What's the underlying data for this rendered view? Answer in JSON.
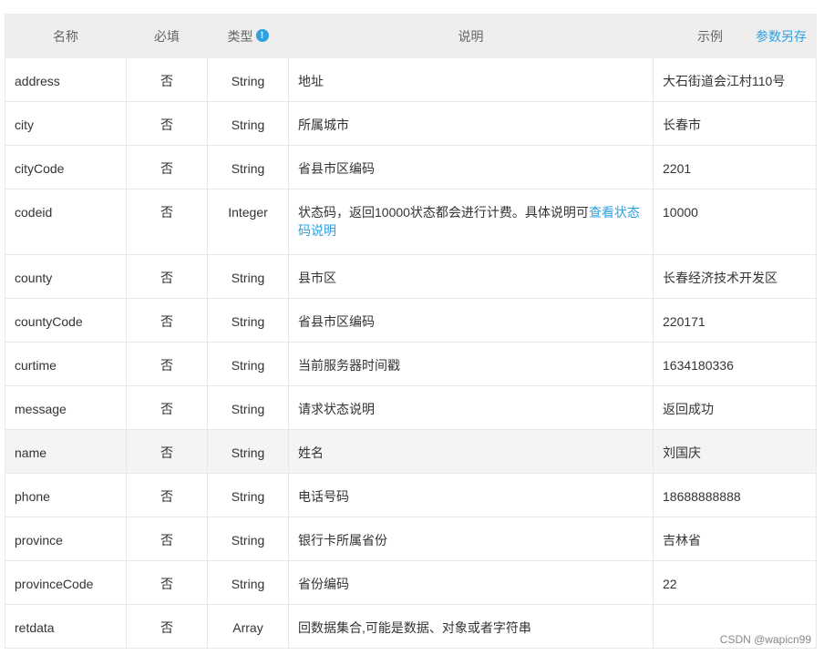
{
  "header": {
    "name": "名称",
    "required": "必填",
    "type": "类型",
    "type_info_icon": "!",
    "description": "说明",
    "example": "示例",
    "save_as": "参数另存"
  },
  "rows": [
    {
      "name": "address",
      "required": "否",
      "type": "String",
      "desc": "地址",
      "example": "大石街道会江村110号"
    },
    {
      "name": "city",
      "required": "否",
      "type": "String",
      "desc": "所属城市",
      "example": "长春市"
    },
    {
      "name": "cityCode",
      "required": "否",
      "type": "String",
      "desc": "省县市区编码",
      "example": "2201"
    },
    {
      "name": "codeid",
      "required": "否",
      "type": "Integer",
      "desc": "状态码，返回10000状态都会进行计费。具体说明可",
      "desc_link": "查看状态码说明",
      "example": "10000"
    },
    {
      "name": "county",
      "required": "否",
      "type": "String",
      "desc": "县市区",
      "example": "长春经济技术开发区"
    },
    {
      "name": "countyCode",
      "required": "否",
      "type": "String",
      "desc": "省县市区编码",
      "example": "220171"
    },
    {
      "name": "curtime",
      "required": "否",
      "type": "String",
      "desc": "当前服务器时间戳",
      "example": "1634180336"
    },
    {
      "name": "message",
      "required": "否",
      "type": "String",
      "desc": "请求状态说明",
      "example": "返回成功"
    },
    {
      "name": "name",
      "required": "否",
      "type": "String",
      "desc": "姓名",
      "example": "刘国庆"
    },
    {
      "name": "phone",
      "required": "否",
      "type": "String",
      "desc": "电话号码",
      "example": "18688888888"
    },
    {
      "name": "province",
      "required": "否",
      "type": "String",
      "desc": "银行卡所属省份",
      "example": "吉林省"
    },
    {
      "name": "provinceCode",
      "required": "否",
      "type": "String",
      "desc": "省份编码",
      "example": "22"
    },
    {
      "name": "retdata",
      "required": "否",
      "type": "Array",
      "desc": "回数据集合,可能是数据、对象或者字符串",
      "example": ""
    }
  ],
  "watermark": "CSDN @wapicn99",
  "colors": {
    "accent": "#2fa0e0",
    "header_bg": "#eeeeee",
    "hover_row_bg": "#f4f4f4"
  }
}
